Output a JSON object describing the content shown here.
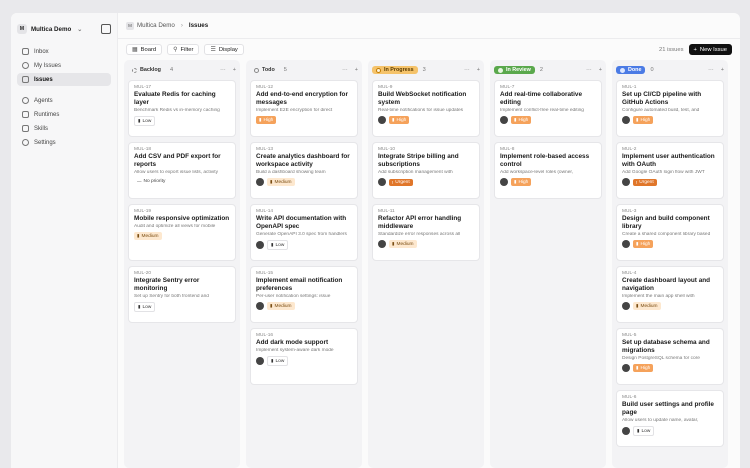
{
  "workspace": {
    "name": "Multica Demo",
    "initial": "M"
  },
  "sidebar": {
    "items": [
      {
        "label": "Inbox",
        "icon": "inbox-icon"
      },
      {
        "label": "My Issues",
        "icon": "user-circle-icon"
      },
      {
        "label": "Issues",
        "icon": "issues-icon",
        "active": true
      },
      {
        "label": "Agents",
        "icon": "agent-icon"
      },
      {
        "label": "Runtimes",
        "icon": "monitor-icon"
      },
      {
        "label": "Skills",
        "icon": "skills-icon"
      },
      {
        "label": "Settings",
        "icon": "gear-icon"
      }
    ]
  },
  "breadcrumb": {
    "workspace": "Multica Demo",
    "current": "Issues"
  },
  "toolbar": {
    "board": "Board",
    "filter": "Filter",
    "display": "Display",
    "count": "21 issues",
    "new_issue": "New Issue"
  },
  "columns": [
    {
      "name": "Backlog",
      "count": "4",
      "style": "backlog",
      "cards": [
        {
          "id": "MUL-17",
          "title": "Evaluate Redis for caching layer",
          "desc": "Benchmark Redis vs in-memory caching",
          "priority": "Low",
          "p": "low",
          "avatar": false
        },
        {
          "id": "MUL-18",
          "title": "Add CSV and PDF export for reports",
          "desc": "Allow users to export issue lists, activity",
          "priority": "No priority",
          "p": "none",
          "avatar": false
        },
        {
          "id": "MUL-19",
          "title": "Mobile responsive optimization",
          "desc": "Audit and optimize all views for mobile",
          "priority": "Medium",
          "p": "medium",
          "avatar": false
        },
        {
          "id": "MUL-20",
          "title": "Integrate Sentry error monitoring",
          "desc": "Set up Sentry for both frontend and",
          "priority": "Low",
          "p": "low",
          "avatar": false
        }
      ]
    },
    {
      "name": "Todo",
      "count": "5",
      "style": "todo",
      "cards": [
        {
          "id": "MUL-12",
          "title": "Add end-to-end encryption for messages",
          "desc": "Implement E2E encryption for direct",
          "priority": "High",
          "p": "high",
          "avatar": false
        },
        {
          "id": "MUL-13",
          "title": "Create analytics dashboard for workspace activity",
          "desc": "Build a dashboard showing team",
          "priority": "Medium",
          "p": "medium",
          "avatar": true
        },
        {
          "id": "MUL-14",
          "title": "Write API documentation with OpenAPI spec",
          "desc": "Generate OpenAPI 3.0 spec from handlers",
          "priority": "Low",
          "p": "low",
          "avatar": true
        },
        {
          "id": "MUL-15",
          "title": "Implement email notification preferences",
          "desc": "Per-user notification settings: issue",
          "priority": "Medium",
          "p": "medium",
          "avatar": true
        },
        {
          "id": "MUL-16",
          "title": "Add dark mode support",
          "desc": "Implement system-aware dark mode",
          "priority": "Low",
          "p": "low",
          "avatar": true
        }
      ]
    },
    {
      "name": "In Progress",
      "count": "3",
      "style": "inprog",
      "cards": [
        {
          "id": "MUL-9",
          "title": "Build WebSocket notification system",
          "desc": "Real-time notifications for issue updates",
          "priority": "High",
          "p": "high",
          "avatar": true
        },
        {
          "id": "MUL-10",
          "title": "Integrate Stripe billing and subscriptions",
          "desc": "Add subscription management with",
          "priority": "Urgent",
          "p": "urgent",
          "avatar": true
        },
        {
          "id": "MUL-11",
          "title": "Refactor API error handling middleware",
          "desc": "Standardize error responses across all",
          "priority": "Medium",
          "p": "medium",
          "avatar": true
        }
      ]
    },
    {
      "name": "In Review",
      "count": "2",
      "style": "review",
      "cards": [
        {
          "id": "MUL-7",
          "title": "Add real-time collaborative editing",
          "desc": "Implement conflict-free real-time editing",
          "priority": "High",
          "p": "high",
          "avatar": true
        },
        {
          "id": "MUL-8",
          "title": "Implement role-based access control",
          "desc": "Add workspace-level roles (owner,",
          "priority": "High",
          "p": "high",
          "avatar": true
        }
      ]
    },
    {
      "name": "Done",
      "count": "0",
      "style": "done",
      "cards": [
        {
          "id": "MUL-1",
          "title": "Set up CI/CD pipeline with GitHub Actions",
          "desc": "Configure automated build, test, and",
          "priority": "High",
          "p": "high",
          "avatar": true
        },
        {
          "id": "MUL-2",
          "title": "Implement user authentication with OAuth",
          "desc": "Add Google OAuth login flow with JWT",
          "priority": "Urgent",
          "p": "urgent",
          "avatar": true
        },
        {
          "id": "MUL-3",
          "title": "Design and build component library",
          "desc": "Create a shared component library based",
          "priority": "High",
          "p": "high",
          "avatar": true
        },
        {
          "id": "MUL-4",
          "title": "Create dashboard layout and navigation",
          "desc": "Implement the main app shell with",
          "priority": "Medium",
          "p": "medium",
          "avatar": true
        },
        {
          "id": "MUL-5",
          "title": "Set up database schema and migrations",
          "desc": "Design PostgreSQL schema for core",
          "priority": "High",
          "p": "high",
          "avatar": true
        },
        {
          "id": "MUL-6",
          "title": "Build user settings and profile page",
          "desc": "Allow users to update name, avatar,",
          "priority": "Low",
          "p": "low",
          "avatar": true
        }
      ]
    }
  ]
}
